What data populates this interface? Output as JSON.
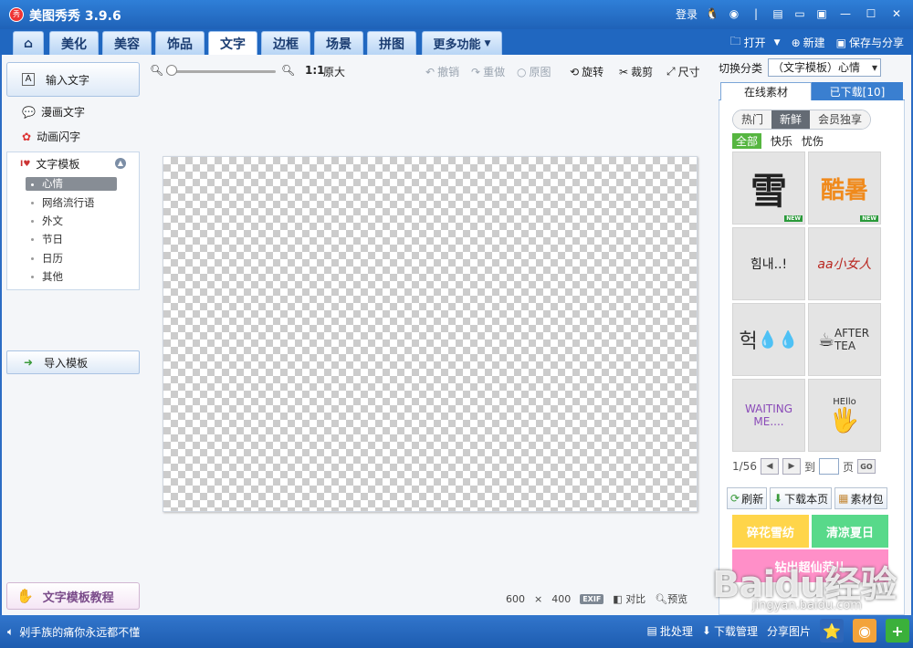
{
  "app": {
    "title": "美图秀秀 3.9.6",
    "logo_text": "秀"
  },
  "titlebar": {
    "login": "登录"
  },
  "tabs": [
    "美化",
    "美容",
    "饰品",
    "文字",
    "边框",
    "场景",
    "拼图"
  ],
  "more_tab": "更多功能",
  "active_tab": "文字",
  "top_actions": {
    "open": "打开",
    "new": "新建",
    "save_share": "保存与分享"
  },
  "left": {
    "input_text": "输入文字",
    "comic_text": "漫画文字",
    "anim_text": "动画闪字",
    "template_head": "文字模板",
    "template_items": [
      "心情",
      "网络流行语",
      "外文",
      "节日",
      "日历",
      "其他"
    ],
    "selected_item": "心情",
    "import_template": "导入模板",
    "tutorial": "文字模板教程"
  },
  "toolbar": {
    "ratio": "1:1",
    "original_size": "原大",
    "undo": "撤销",
    "redo": "重做",
    "original": "原图",
    "rotate": "旋转",
    "crop": "裁剪",
    "size": "尺寸"
  },
  "canvas": {
    "width_val": "600",
    "times": "×",
    "height_val": "400",
    "exif": "EXIF",
    "compare": "对比",
    "preview": "预览"
  },
  "right": {
    "switch_label": "切换分类",
    "switch_value": "（文字模板）心情",
    "tab_online": "在线素材",
    "tab_downloaded": "已下载[10]",
    "filters": [
      "热门",
      "新鲜",
      "会员独享"
    ],
    "selected_filter": "新鲜",
    "categories": [
      "全部",
      "快乐",
      "忧伤"
    ],
    "selected_category": "全部",
    "stickers": [
      "雪",
      "酷暑",
      "힘내..!",
      "aa小女人",
      "헉",
      "AFTER TEA",
      "WAITING ME....",
      "HEllo"
    ],
    "new_tag": "NEW",
    "pager": {
      "page": "1/56",
      "to": "到",
      "page_unit": "页",
      "go": "GO"
    },
    "actions": {
      "refresh": "刷新",
      "download_page": "下载本页",
      "material_pack": "素材包"
    },
    "banners": [
      "碎花雪纺",
      "清凉夏日",
      "钻出超仙范儿"
    ]
  },
  "status": {
    "message": "剁手族的痛你永远都不懂",
    "batch": "批处理",
    "download_mgr": "下载管理",
    "share": "分享图片"
  },
  "watermark": {
    "logo": "Baidu经验",
    "url": "jingyan.baidu.com"
  },
  "colors": {
    "titlebar": "#2f7fd8",
    "accent_green": "#56b640",
    "banner_yellow": "#ffd54a",
    "banner_green": "#58d98a",
    "banner_pink": "#ff8fc8"
  }
}
